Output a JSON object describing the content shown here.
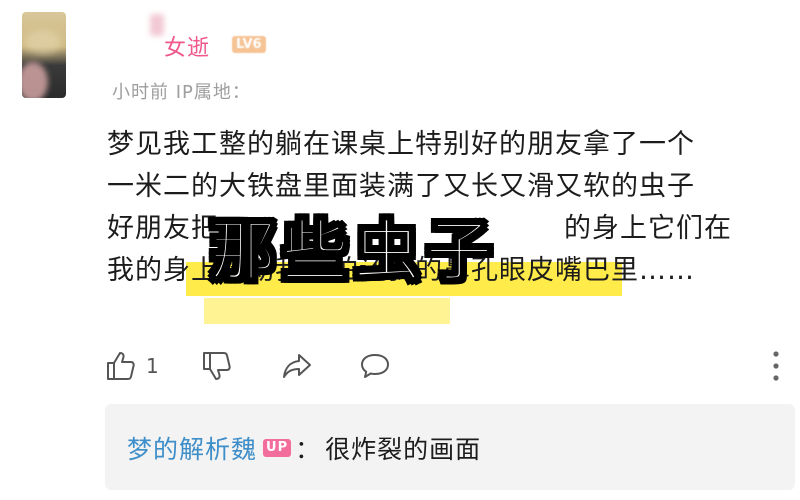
{
  "comment": {
    "username": "女逝",
    "level_badge": "LV6",
    "meta": "小时前 IP属地：",
    "text_lines": [
      "梦见我工整的躺在课桌上特别好的朋友拿了一个",
      "一米二的大铁盘里面装满了又长又滑又软的虫子",
      "好朋友把                                    的身上它们在",
      "我的身上蠕动我回怕还我的鼻孔眼皮嘴巴里……"
    ],
    "like_count": "1"
  },
  "overlay_title": "那些虫子",
  "reply": {
    "author": "梦的解析魏",
    "badge": "UP",
    "separator": "：",
    "text": "很炸裂的画面"
  },
  "icons": {
    "like": "thumbs-up-icon",
    "dislike": "thumbs-down-icon",
    "share": "share-icon",
    "comment": "comment-bubble-icon",
    "more": "more-vertical-icon"
  },
  "colors": {
    "username": "#f0588b",
    "reply_author": "#3e8ec9",
    "highlight": "#ffe93a",
    "up_badge": "#f26d9b"
  }
}
